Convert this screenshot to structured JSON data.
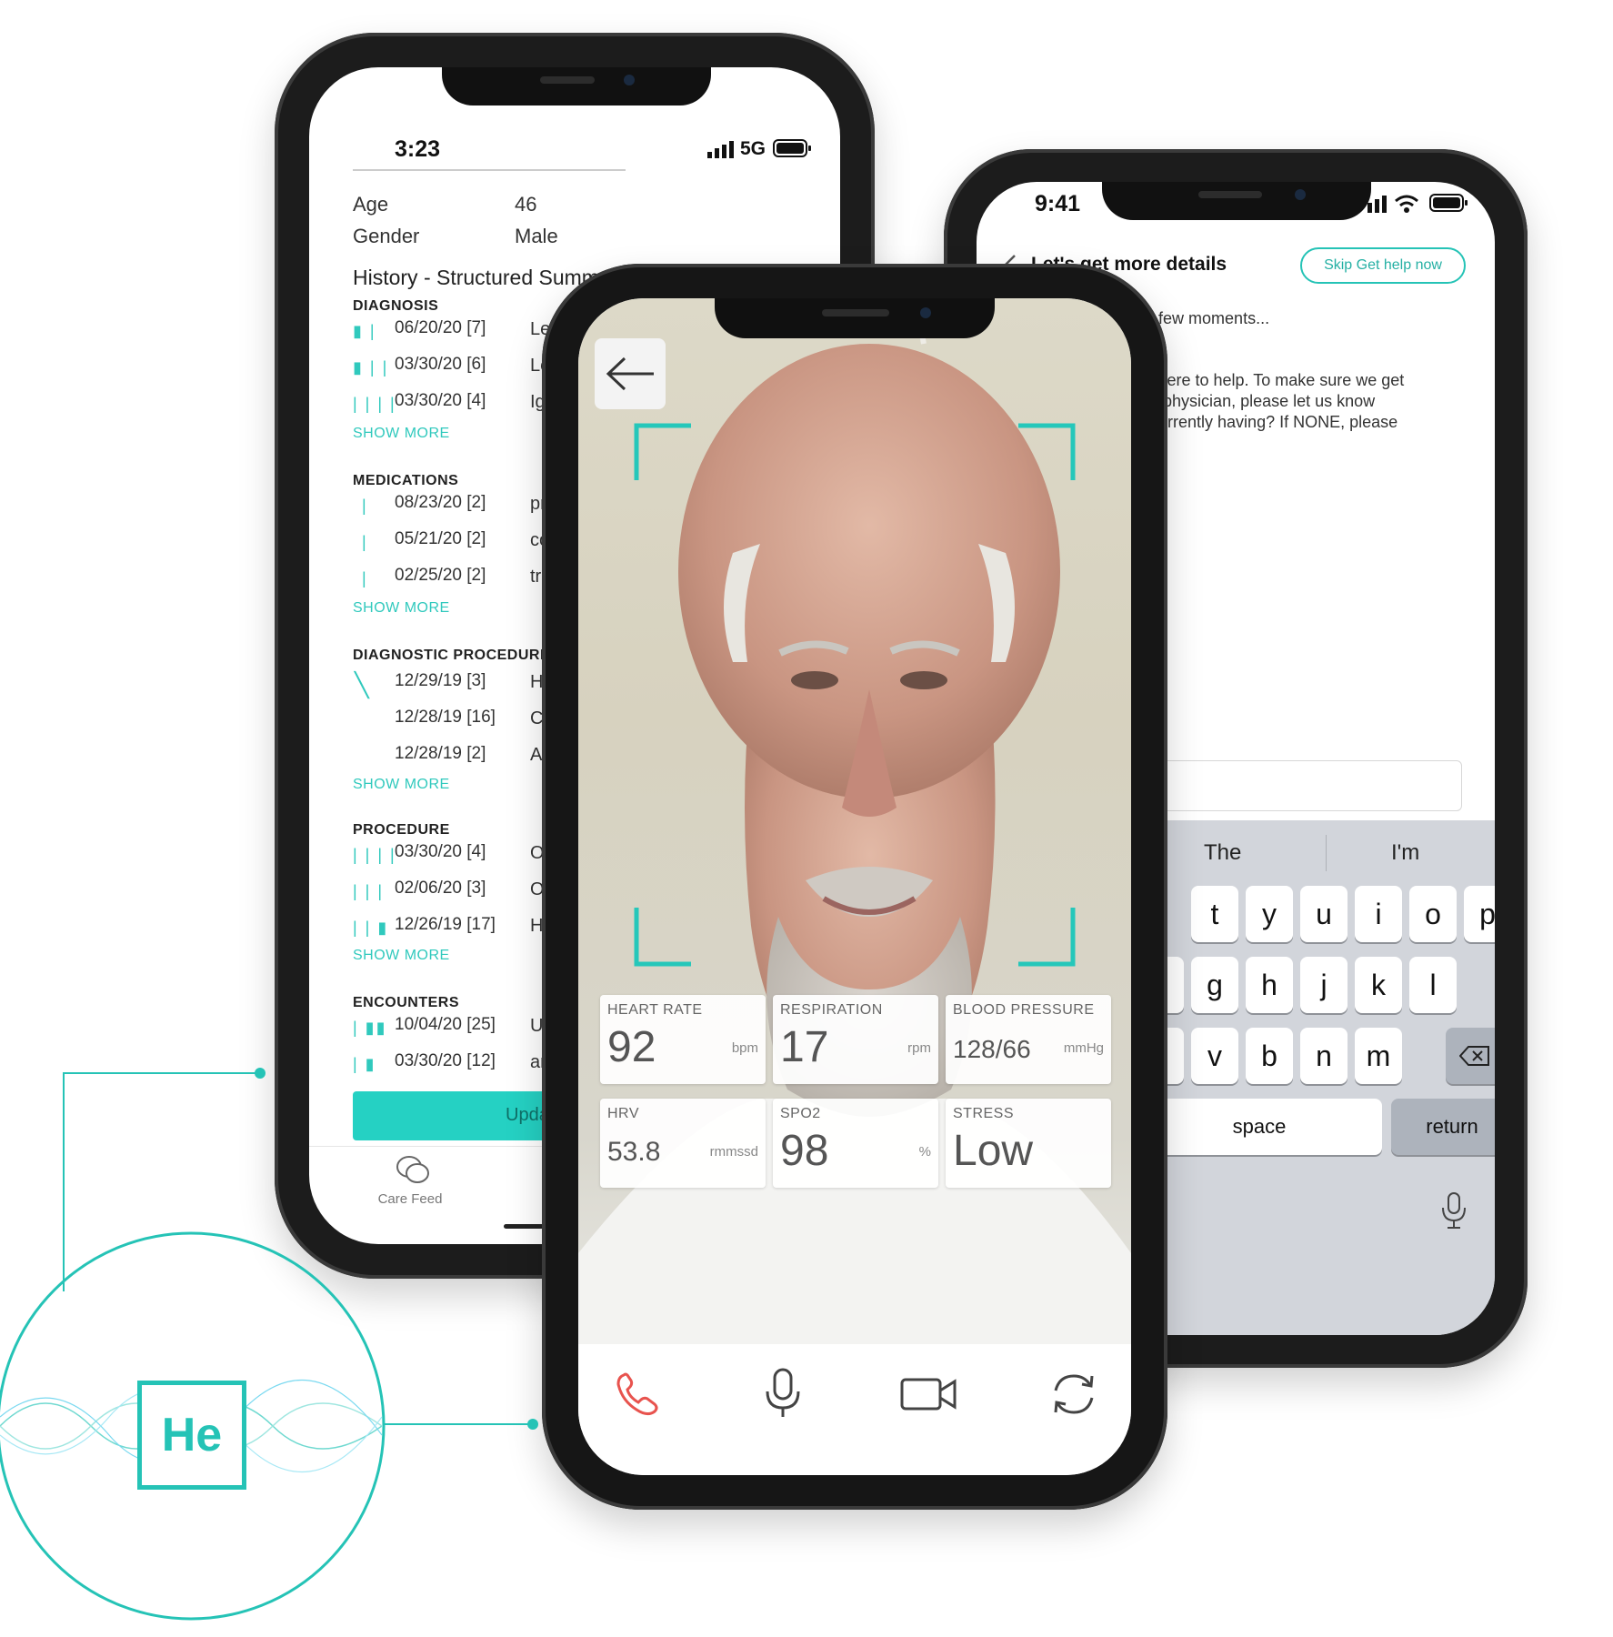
{
  "left_phone": {
    "status": {
      "time": "3:23",
      "network": "5G"
    },
    "patient": [
      {
        "label": "Age",
        "value": "46"
      },
      {
        "label": "Gender",
        "value": "Male"
      }
    ],
    "history_title": "History - Structured Summary",
    "sections": [
      {
        "title": "DIAGNOSIS",
        "rows": [
          {
            "bars": "▮ |",
            "date": "06/20/20 [7]",
            "frag": "Le"
          },
          {
            "bars": "▮ | |",
            "date": "03/30/20 [6]",
            "frag": "Le"
          },
          {
            "bars": "| | | |",
            "date": "03/30/20 [4]",
            "frag": "Ig"
          }
        ],
        "show_more": "SHOW MORE"
      },
      {
        "title": "MEDICATIONS",
        "rows": [
          {
            "bars": "|",
            "date": "08/23/20 [2]",
            "frag": "pr"
          },
          {
            "bars": "|",
            "date": "05/21/20 [2]",
            "frag": "co"
          },
          {
            "bars": "|",
            "date": "02/25/20 [2]",
            "frag": "tr"
          }
        ],
        "show_more": "SHOW MORE"
      },
      {
        "title": "DIAGNOSTIC PROCEDURE",
        "rows": [
          {
            "bars": "╲",
            "date": "12/29/19 [3]",
            "frag": "H"
          },
          {
            "bars": "",
            "date": "12/28/19 [16]",
            "frag": "C"
          },
          {
            "bars": "",
            "date": "12/28/19 [2]",
            "frag": "Ar"
          }
        ],
        "show_more": "SHOW MORE"
      },
      {
        "title": "PROCEDURE",
        "rows": [
          {
            "bars": "| | | |",
            "date": "03/30/20 [4]",
            "frag": "O"
          },
          {
            "bars": "| | |",
            "date": "02/06/20 [3]",
            "frag": "O"
          },
          {
            "bars": "| | ▮",
            "date": "12/26/19 [17]",
            "frag": "H"
          }
        ],
        "show_more": "SHOW MORE"
      },
      {
        "title": "ENCOUNTERS",
        "rows": [
          {
            "bars": "| ▮▮",
            "date": "10/04/20 [25]",
            "frag": "U"
          },
          {
            "bars": "| ▮",
            "date": "03/30/20 [12]",
            "frag": "ar"
          }
        ]
      }
    ],
    "update_button": "Upda",
    "tab_care_feed": "Care Feed"
  },
  "right_phone": {
    "status": {
      "time": "9:41"
    },
    "header_title": "Let's get more details",
    "skip_button": "Skip Get help now",
    "msg1": "ne a few moments...",
    "msg2_l1": "/e're here to help. To make sure we get",
    "msg2_l2": "pe of physician, please let us know",
    "msg2_l3": "are currently having? If NONE, please",
    "suggestions": [
      "The",
      "I'm"
    ],
    "row1": [
      "t",
      "y",
      "u",
      "i",
      "o",
      "p"
    ],
    "row2": [
      "f",
      "g",
      "h",
      "j",
      "k",
      "l"
    ],
    "row3": [
      "c",
      "v",
      "b",
      "n",
      "m"
    ],
    "space": "space",
    "return": "return"
  },
  "center_phone": {
    "vitals": [
      {
        "label": "HEART RATE",
        "value": "92",
        "unit": "bpm"
      },
      {
        "label": "RESPIRATION",
        "value": "17",
        "unit": "rpm"
      },
      {
        "label": "BLOOD PRESSURE",
        "value": "128/66",
        "unit": "mmHg"
      },
      {
        "label": "HRV",
        "value": "53.8",
        "unit": "rmmssd"
      },
      {
        "label": "SPO2",
        "value": "98",
        "unit": "%"
      },
      {
        "label": "STRESS",
        "value": "Low",
        "unit": ""
      }
    ]
  },
  "logo": {
    "text": "He"
  },
  "colors": {
    "accent": "#25c3b6",
    "call": "#e8534e",
    "frame": "#1c1c1c"
  }
}
